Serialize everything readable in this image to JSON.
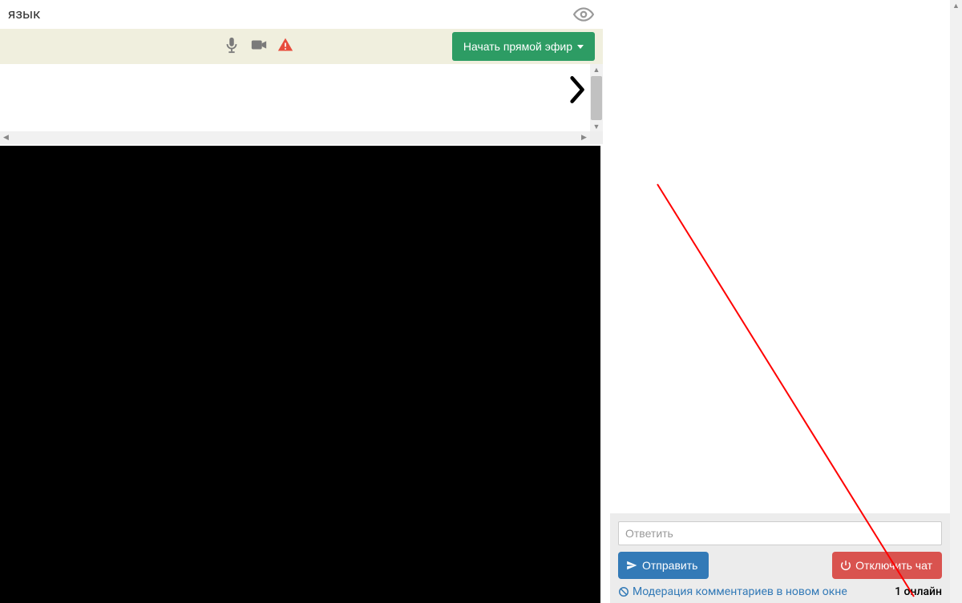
{
  "header": {
    "title": "язык"
  },
  "toolbar": {
    "start_live_label": "Начать прямой эфир"
  },
  "chat": {
    "input_placeholder": "Ответить",
    "send_label": "Отправить",
    "disable_chat_label": "Отключить чат",
    "moderation_link": "Модерация комментариев в новом окне",
    "online_count_text": "1 онлайн"
  },
  "colors": {
    "toolbar_bg": "#f0efde",
    "green_btn": "#2d9c64",
    "blue_btn": "#337ab7",
    "red_btn": "#d9534f",
    "link": "#337ab7",
    "annotation_red": "#ff0000"
  }
}
